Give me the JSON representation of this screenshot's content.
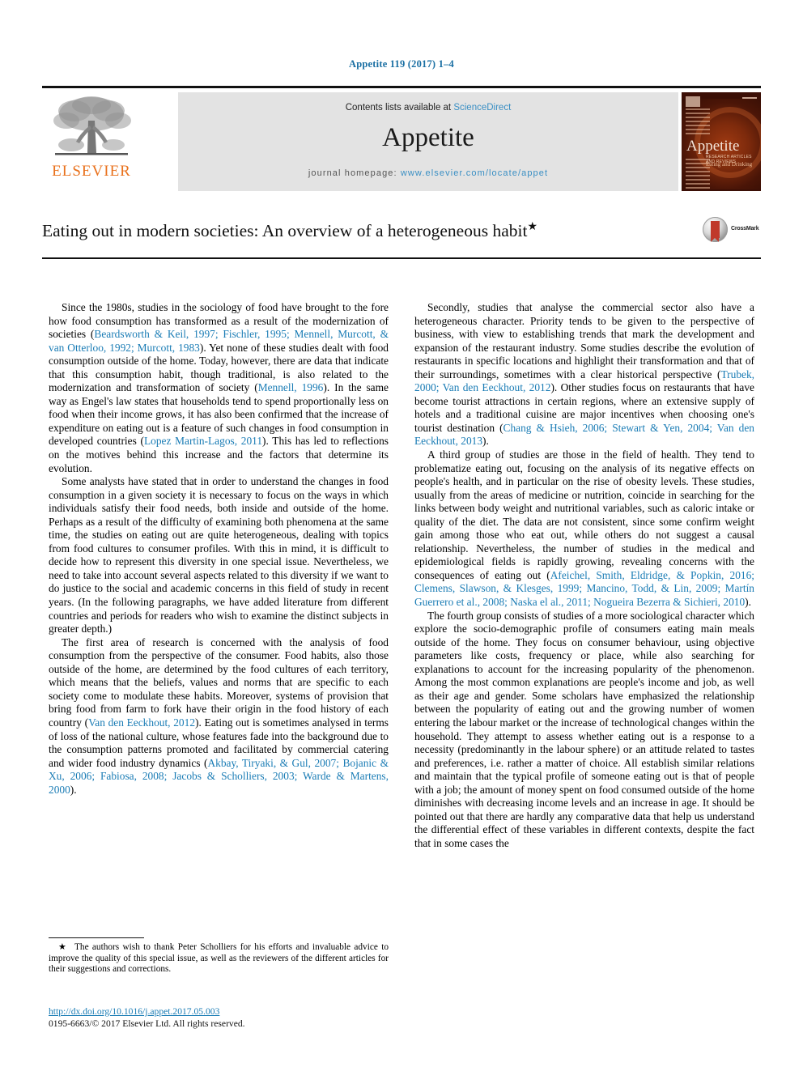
{
  "running_head": "Appetite 119 (2017) 1–4",
  "masthead": {
    "contents_prefix": "Contents lists available at ",
    "sciencedirect": "ScienceDirect",
    "journal_name": "Appetite",
    "homepage_prefix": "journal homepage: ",
    "homepage_url": "www.elsevier.com/locate/appet",
    "publisher": "ELSEVIER",
    "cover": {
      "title": "Appetite",
      "subtitle_small": "RESEARCH ARTICLES AND REVIEWS",
      "subtitle": "Eating and Drinking"
    },
    "logo_icon": "elsevier-tree-icon",
    "accent_orange": "#E9711C",
    "link_blue": "#3a8fc4",
    "panel_gray": "#e3e3e3"
  },
  "article": {
    "title": "Eating out in modern societies: An overview of a heterogeneous habit",
    "title_footnote_marker": "★",
    "crossmark_label": "CrossMark"
  },
  "colors": {
    "citation_blue": "#1a7cb5",
    "header_blue": "#1a6fa3"
  },
  "body": {
    "left_column": [
      {
        "id": "p1",
        "html": "Since the 1980s, studies in the sociology of food have brought to the fore how food consumption has transformed as a result of the modernization of societies (<a class=\"cite\" data-name=\"citation-link\" data-interactable=\"true\">Beardsworth &amp; Keil, 1997; Fischler, 1995; Mennell, Murcott, &amp; van Otterloo, 1992; Murcott, 1983</a>). Yet none of these studies dealt with food consumption outside of the home. Today, however, there are data that indicate that this consumption habit, though traditional, is also related to the modernization and transformation of society (<a class=\"cite\" data-name=\"citation-link\" data-interactable=\"true\">Mennell, 1996</a>). In the same way as Engel's law states that households tend to spend proportionally less on food when their income grows, it has also been confirmed that the increase of expenditure on eating out is a feature of such changes in food consumption in developed countries (<a class=\"cite\" data-name=\"citation-link\" data-interactable=\"true\">Lopez Martin-Lagos, 2011</a>). This has led to reflections on the motives behind this increase and the factors that determine its evolution."
      },
      {
        "id": "p2",
        "html": "Some analysts have stated that in order to understand the changes in food consumption in a given society it is necessary to focus on the ways in which individuals satisfy their food needs, both inside and outside of the home. Perhaps as a result of the difficulty of examining both phenomena at the same time, the studies on eating out are quite heterogeneous, dealing with topics from food cultures to consumer profiles. With this in mind, it is difficult to decide how to represent this diversity in one special issue. Nevertheless, we need to take into account several aspects related to this diversity if we want to do justice to the social and academic concerns in this field of study in recent years. (In the following paragraphs, we have added literature from different countries and periods for readers who wish to examine the distinct subjects in greater depth.)"
      },
      {
        "id": "p3",
        "html": "The first area of research is concerned with the analysis of food consumption from the perspective of the consumer. Food habits, also those outside of the home, are determined by the food cultures of each territory, which means that the beliefs, values and norms that are specific to each society come to modulate these habits. Moreover, systems of provision that bring food from farm to fork have their origin in the food history of each country (<a class=\"cite\" data-name=\"citation-link\" data-interactable=\"true\">Van den Eeckhout, 2012</a>). Eating out is sometimes analysed in terms of loss of the national culture, whose features fade into the background due to the consumption patterns promoted and facilitated by commercial catering and wider food industry dynamics (<a class=\"cite\" data-name=\"citation-link\" data-interactable=\"true\">Akbay, Tiryaki, &amp; Gul, 2007; Bojanic &amp; Xu, 2006; Fabiosa, 2008; Jacobs &amp; Scholliers, 2003; Warde &amp; Martens, 2000</a>)."
      }
    ],
    "right_column": [
      {
        "id": "p4",
        "html": "Secondly, studies that analyse the commercial sector also have a heterogeneous character. Priority tends to be given to the perspective of business, with view to establishing trends that mark the development and expansion of the restaurant industry. Some studies describe the evolution of restaurants in specific locations and highlight their transformation and that of their surroundings, sometimes with a clear historical perspective (<a class=\"cite\" data-name=\"citation-link\" data-interactable=\"true\">Trubek, 2000; Van den Eeckhout, 2012</a>). Other studies focus on restaurants that have become tourist attractions in certain regions, where an extensive supply of hotels and a traditional cuisine are major incentives when choosing one's tourist destination (<a class=\"cite\" data-name=\"citation-link\" data-interactable=\"true\">Chang &amp; Hsieh, 2006; Stewart &amp; Yen, 2004; Van den Eeckhout, 2013</a>)."
      },
      {
        "id": "p5",
        "html": "A third group of studies are those in the field of health. They tend to problematize eating out, focusing on the analysis of its negative effects on people's health, and in particular on the rise of obesity levels. These studies, usually from the areas of medicine or nutrition, coincide in searching for the links between body weight and nutritional variables, such as caloric intake or quality of the diet. The data are not consistent, since some confirm weight gain among those who eat out, while others do not suggest a causal relationship. Nevertheless, the number of studies in the medical and epidemiological fields is rapidly growing, revealing concerns with the consequences of eating out (<a class=\"cite\" data-name=\"citation-link\" data-interactable=\"true\">Afeichel, Smith, Eldridge, &amp; Popkin, 2016; Clemens, Slawson, &amp; Klesges, 1999; Mancino, Todd, &amp; Lin, 2009; Martín Guerrero et al., 2008; Naska el al., 2011; Nogueira Bezerra &amp; Sichieri, 2010</a>)."
      },
      {
        "id": "p6",
        "html": "The fourth group consists of studies of a more sociological character which explore the socio-demographic profile of consumers eating main meals outside of the home. They focus on consumer behaviour, using objective parameters like costs, frequency or place, while also searching for explanations to account for the increasing popularity of the phenomenon. Among the most common explanations are people's income and job, as well as their age and gender. Some scholars have emphasized the relationship between the popularity of eating out and the growing number of women entering the labour market or the increase of technological changes within the household. They attempt to assess whether eating out is a response to a necessity (predominantly in the labour sphere) or an attitude related to tastes and preferences, i.e. rather a matter of choice. All establish similar relations and maintain that the typical profile of someone eating out is that of people with a job; the amount of money spent on food consumed outside of the home diminishes with decreasing income levels and an increase in age. It should be pointed out that there are hardly any comparative data that help us understand the differential effect of these variables in different contexts, despite the fact that in some cases the"
      }
    ]
  },
  "footnote": {
    "marker": "★",
    "text": "The authors wish to thank Peter Scholliers for his efforts and invaluable advice to improve the quality of this special issue, as well as the reviewers of the different articles for their suggestions and corrections."
  },
  "footer": {
    "doi": "http://dx.doi.org/10.1016/j.appet.2017.05.003",
    "copyright": "0195-6663/© 2017 Elsevier Ltd. All rights reserved."
  }
}
